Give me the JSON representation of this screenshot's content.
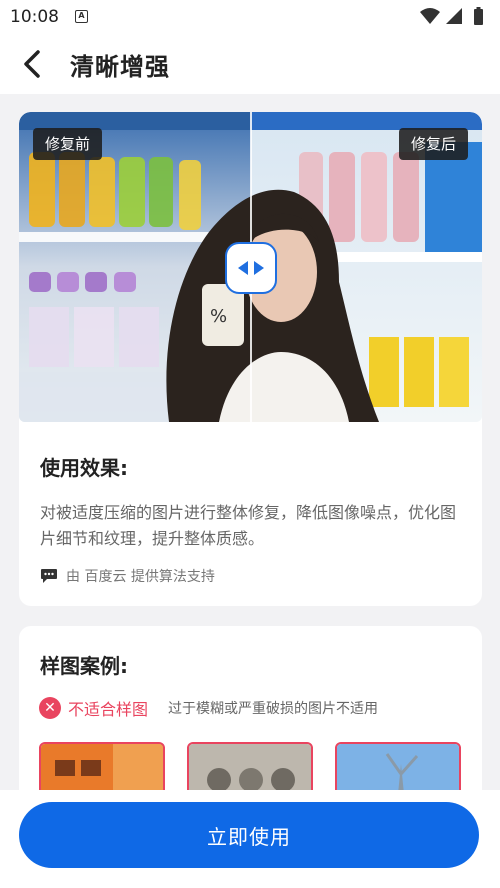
{
  "status_bar": {
    "time": "10:08",
    "notification_glyph": "A"
  },
  "header": {
    "title": "清晰增强",
    "back_icon": "chevron-left-icon"
  },
  "compare": {
    "before_label": "修复前",
    "after_label": "修复后",
    "handle_icon": "left-right-arrows-icon"
  },
  "effect": {
    "title": "使用效果:",
    "description": "对被适度压缩的图片进行整体修复，降低图像噪点，优化图片细节和纹理，提升整体质感。",
    "credit": "由 百度云 提供算法支持"
  },
  "samples": {
    "title": "样图案例:",
    "unsuitable_label": "不适合样图",
    "unsuitable_note": "过于模糊或严重破损的图片不适用"
  },
  "action": {
    "use_button_label": "立即使用"
  },
  "colors": {
    "accent": "#0f69e6",
    "warning": "#e9445f"
  }
}
